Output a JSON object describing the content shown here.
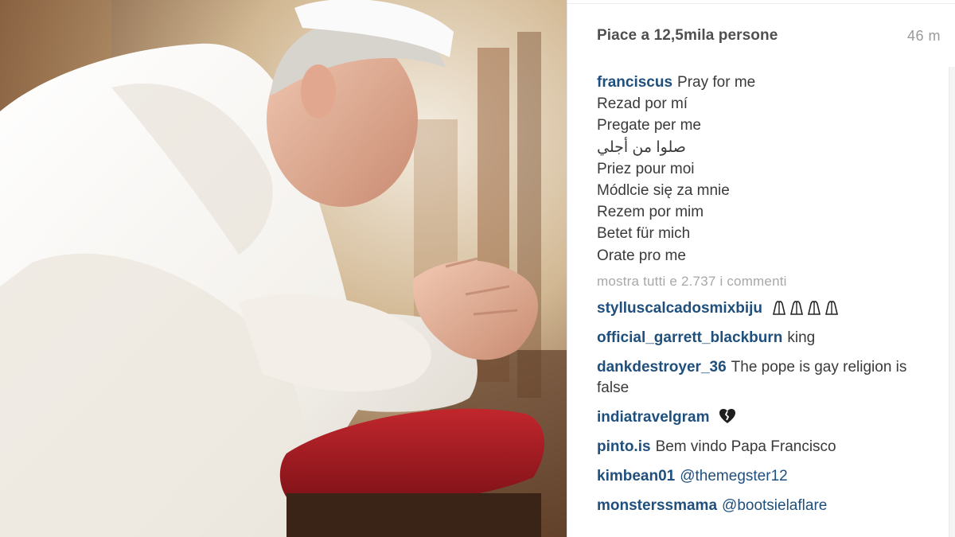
{
  "post": {
    "likes": "Piace a 12,5mila persone",
    "time": "46 m"
  },
  "caption": {
    "user": "franciscus",
    "lines": [
      "Pray for me",
      "Rezad por mí",
      "Pregate per me",
      "صلوا من أجلي",
      "Priez pour moi",
      "Módlcie się za mnie",
      "Rezem por mim",
      "Betet für mich",
      "Orate pro me"
    ]
  },
  "view_all": "mostra tutti e 2.737 i commenti",
  "comments": [
    {
      "user": "stylluscalcadosmixbiju",
      "text": "",
      "icon": "praying-hands-icon"
    },
    {
      "user": "official_garrett_blackburn",
      "text": "king"
    },
    {
      "user": "dankdestroyer_36",
      "text": "The pope is gay religion is false"
    },
    {
      "user": "indiatravelgram",
      "text": "",
      "icon": "broken-heart-icon"
    },
    {
      "user": "pinto.is",
      "text": "Bem vindo Papa Francisco"
    },
    {
      "user": "kimbean01",
      "text": "@themegster12"
    },
    {
      "user": "monsterssmama",
      "text": "@bootsielaflare"
    }
  ],
  "colors": {
    "username": "#1f4f7d",
    "text": "#3a3a3a",
    "muted": "#a8a8a8"
  }
}
